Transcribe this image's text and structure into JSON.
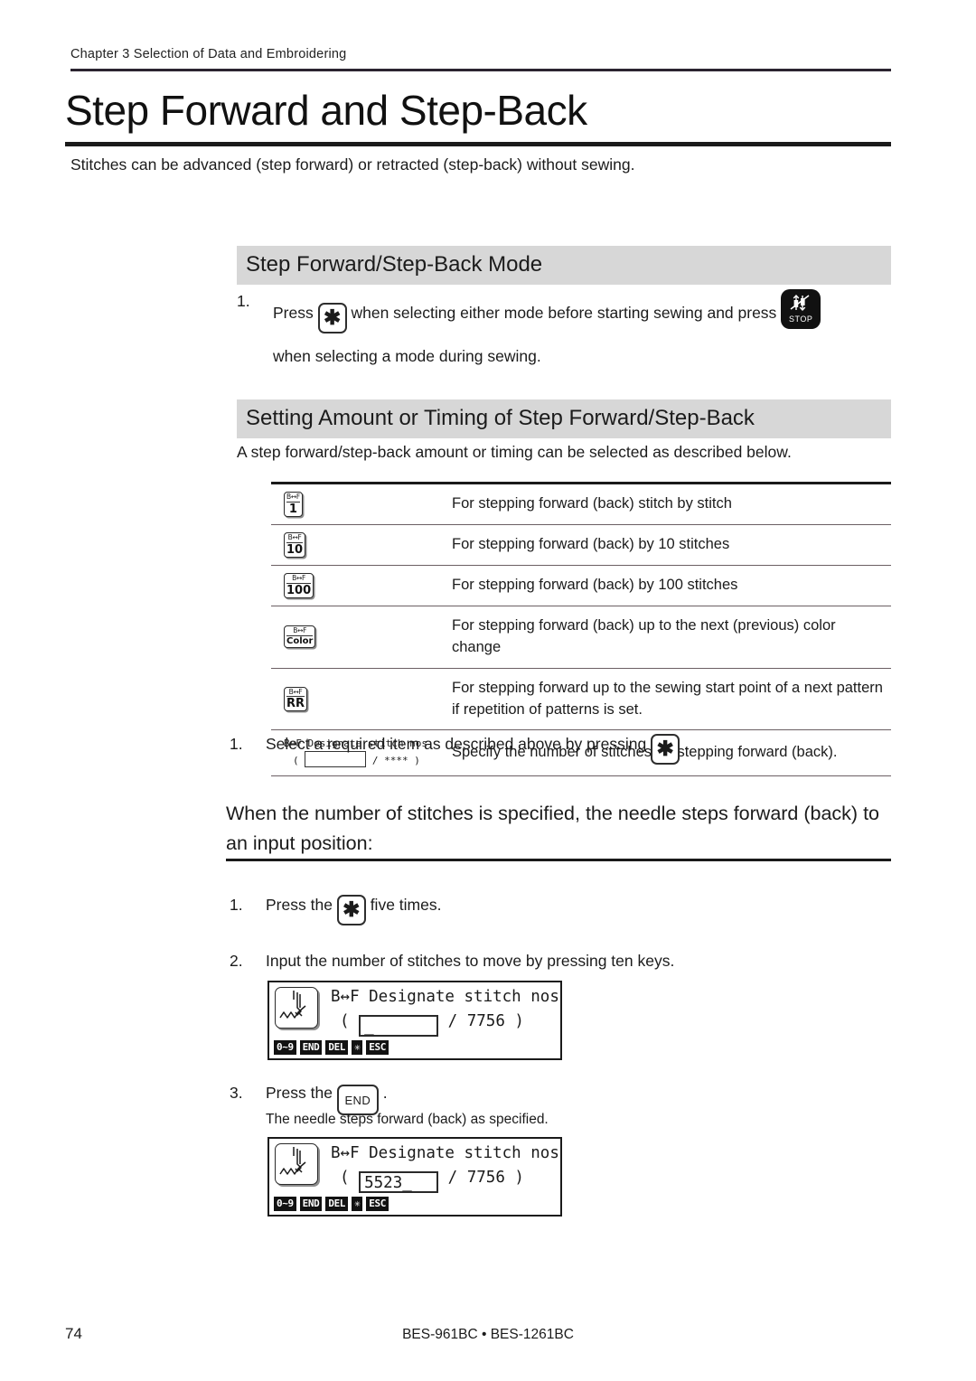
{
  "header": {
    "running_head": "Chapter 3 Selection of Data and Embroidering",
    "page_title": "Step Forward and Step-Back",
    "intro": "Stitches can be advanced (step forward) or retracted (step-back) without sewing."
  },
  "section1": {
    "heading": "Step Forward/Step-Back Mode",
    "step_number": "1.",
    "text_before_key": "Press",
    "key_label": "✱",
    "text_middle": "when selecting either mode before starting sewing and press",
    "stop_button_label": "STOP",
    "text_after": "when selecting a mode during sewing."
  },
  "section2": {
    "heading": "Setting Amount or Timing of Step Forward/Step-Back",
    "intro": "A step forward/step-back amount or timing can be selected as described below.",
    "table": [
      {
        "icon_top": "B↔F",
        "icon_bottom": "1",
        "description": "For stepping forward (back) stitch by stitch"
      },
      {
        "icon_top": "B↔F",
        "icon_bottom": "10",
        "description": "For stepping forward (back) by 10 stitches"
      },
      {
        "icon_top": "B↔F",
        "icon_bottom": "100",
        "description": "For stepping forward (back) by 100 stitches"
      },
      {
        "icon_top": "B↔F",
        "icon_bottom": "Color",
        "description": "For stepping forward (back) up to the next (previous) color change"
      },
      {
        "icon_top": "B↔F",
        "icon_bottom": "RR",
        "description": "For stepping forward up to the sewing start point of a next pattern if repetition of patterns is set."
      },
      {
        "icon_lcd_line1": "B↔F Designate stitch nos",
        "icon_lcd_prefix": "(",
        "icon_lcd_value": "",
        "icon_lcd_suffix": "/ **** )",
        "description": "Specify the number of stitches for stepping forward (back)."
      }
    ],
    "step_number": "1.",
    "step_text_before": "Select a required item as described above by pressing",
    "step_key_label": "✱",
    "step_text_after": "."
  },
  "section3": {
    "heading": "When the number of stitches is specified, the needle steps forward (back) to an input position:",
    "steps": [
      {
        "number": "1.",
        "text_before": "Press the",
        "key_label": "✱",
        "text_after": "five times."
      },
      {
        "number": "2.",
        "text_before": "Input the number of stitches to move by pressing ten keys.",
        "key_label": "",
        "text_after": ""
      },
      {
        "number": "3.",
        "text_before": "Press the",
        "key_label": "END",
        "text_after": ".",
        "caption": "The needle steps forward (back) as specified."
      }
    ],
    "lcd1": {
      "line1": "B↔F Designate stitch nos",
      "prefix": "(",
      "value": "_",
      "suffix": "/ 7756 )",
      "softkeys": [
        "0~9",
        "END",
        "DEL",
        "✳",
        "ESC"
      ]
    },
    "lcd2": {
      "line1": "B↔F Designate stitch nos",
      "prefix": "(",
      "value": "5523_",
      "suffix": "/ 7756 )",
      "softkeys": [
        "0~9",
        "END",
        "DEL",
        "✳",
        "ESC"
      ]
    }
  },
  "footer": {
    "page_number": "74",
    "model": "BES-961BC • BES-1261BC"
  }
}
